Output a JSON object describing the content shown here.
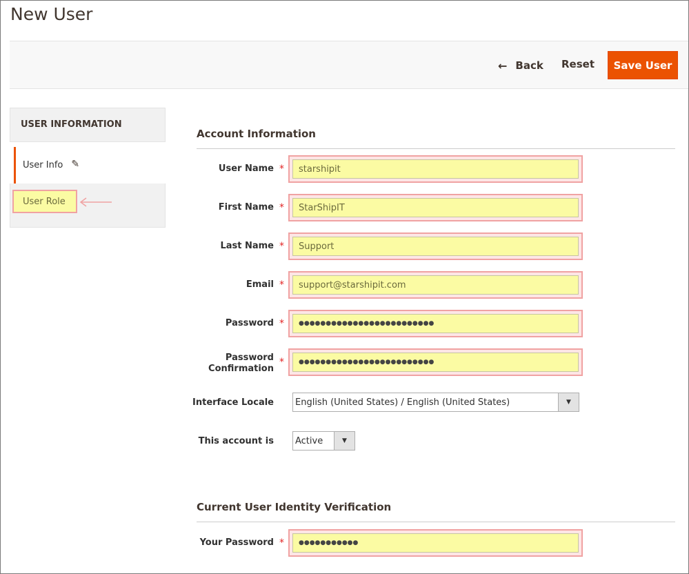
{
  "page": {
    "title": "New User"
  },
  "actions": {
    "back_label": "Back",
    "reset_label": "Reset",
    "save_label": "Save User"
  },
  "sidebar": {
    "title": "USER INFORMATION",
    "items": [
      {
        "label": "User Info"
      },
      {
        "label": "User Role"
      }
    ]
  },
  "account_section": {
    "title": "Account Information",
    "fields": {
      "username": {
        "label": "User Name",
        "value": "starshipit"
      },
      "firstname": {
        "label": "First Name",
        "value": "StarShipIT"
      },
      "lastname": {
        "label": "Last Name",
        "value": "Support"
      },
      "email": {
        "label": "Email",
        "value": "support@starshipit.com"
      },
      "password": {
        "label": "Password",
        "value": "●●●●●●●●●●●●●●●●●●●●●●●●●"
      },
      "password_confirmation": {
        "label_line1": "Password",
        "label_line2": "Confirmation",
        "value": "●●●●●●●●●●●●●●●●●●●●●●●●●"
      },
      "interface_locale": {
        "label": "Interface Locale",
        "value": "English (United States) / English (United States)"
      },
      "account_status": {
        "label": "This account is",
        "value": "Active"
      }
    }
  },
  "verification_section": {
    "title": "Current User Identity Verification",
    "fields": {
      "current_password": {
        "label": "Your Password",
        "value": "●●●●●●●●●●●"
      }
    }
  },
  "required_marker": "*",
  "colors": {
    "accent": "#eb5202",
    "highlight": "#fbfba3",
    "highlight_border": "#f0a2a2",
    "required": "#e22626"
  },
  "icons": {
    "back": "arrow-left-icon",
    "edit": "pencil-icon",
    "dropdown": "triangle-down-icon",
    "annotation": "pink-arrow-icon"
  }
}
